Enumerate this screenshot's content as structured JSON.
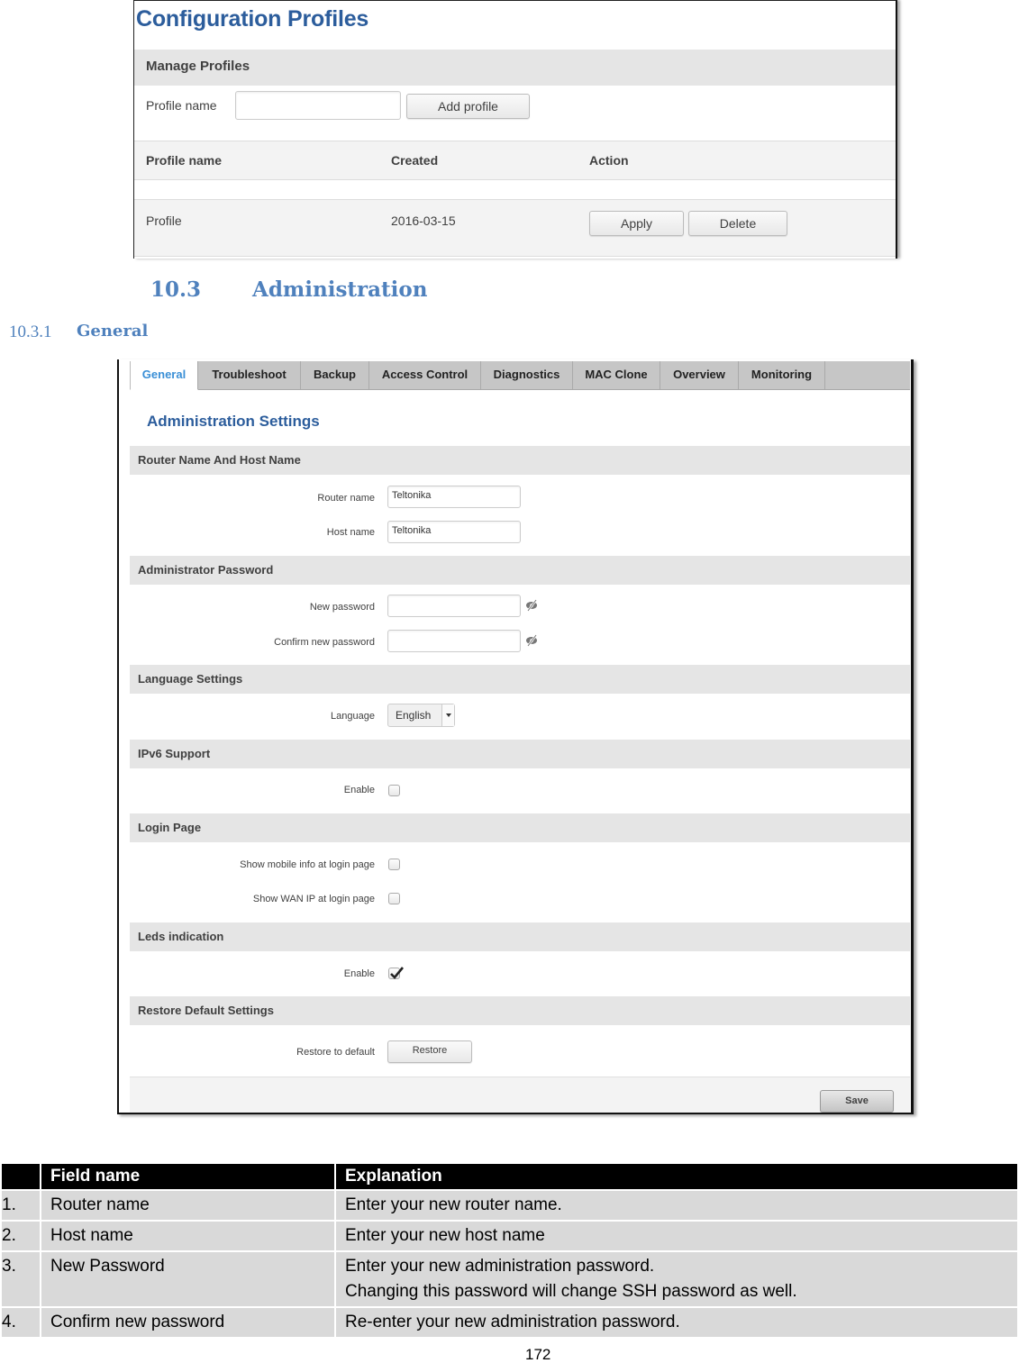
{
  "config_profiles": {
    "title": "Configuration Profiles",
    "section_title": "Manage Profiles",
    "profile_name_label": "Profile name",
    "profile_name_value": "",
    "add_button": "Add profile",
    "table": {
      "headers": [
        "Profile name",
        "Created",
        "Action"
      ],
      "rows": [
        {
          "name": "Profile",
          "created": "2016-03-15",
          "actions": [
            "Apply",
            "Delete"
          ]
        }
      ]
    }
  },
  "doc": {
    "section_number": "10.3",
    "section_title": "Administration",
    "subsection_number": "10.3.1",
    "subsection_title": "General",
    "page_number": "172"
  },
  "admin": {
    "tabs": [
      {
        "label": "General",
        "active": true
      },
      {
        "label": "Troubleshoot",
        "active": false
      },
      {
        "label": "Backup",
        "active": false
      },
      {
        "label": "Access Control",
        "active": false
      },
      {
        "label": "Diagnostics",
        "active": false
      },
      {
        "label": "MAC Clone",
        "active": false
      },
      {
        "label": "Overview",
        "active": false
      },
      {
        "label": "Monitoring",
        "active": false
      }
    ],
    "title": "Administration Settings",
    "sections": {
      "router": {
        "title": "Router Name And Host Name",
        "router_name_label": "Router name",
        "router_name_value": "Teltonika",
        "host_name_label": "Host name",
        "host_name_value": "Teltonika"
      },
      "password": {
        "title": "Administrator Password",
        "new_label": "New password",
        "new_value": "",
        "confirm_label": "Confirm new password",
        "confirm_value": "",
        "toggle_icon": "eye-slash-icon"
      },
      "language": {
        "title": "Language Settings",
        "label": "Language",
        "selected": "English"
      },
      "ipv6": {
        "title": "IPv6 Support",
        "enable_label": "Enable",
        "enabled": false
      },
      "login": {
        "title": "Login Page",
        "mobile_info_label": "Show mobile info at login page",
        "mobile_info_checked": false,
        "wan_ip_label": "Show WAN IP at login page",
        "wan_ip_checked": false
      },
      "leds": {
        "title": "Leds indication",
        "enable_label": "Enable",
        "enabled": true
      },
      "restore": {
        "title": "Restore Default Settings",
        "label": "Restore to default",
        "button": "Restore"
      }
    },
    "save_button": "Save"
  },
  "field_table": {
    "headers": [
      "",
      "Field name",
      "Explanation"
    ],
    "rows": [
      {
        "num": "1.",
        "field": "Router name",
        "explanation": [
          "Enter your new router name."
        ]
      },
      {
        "num": "2.",
        "field": "Host name",
        "explanation": [
          "Enter your new host name"
        ]
      },
      {
        "num": "3.",
        "field": "New Password",
        "explanation": [
          "Enter your new administration password.",
          "Changing this password will change SSH password as well."
        ]
      },
      {
        "num": "4.",
        "field": "Confirm new password",
        "explanation": [
          "Re-enter your new administration password."
        ]
      }
    ]
  }
}
